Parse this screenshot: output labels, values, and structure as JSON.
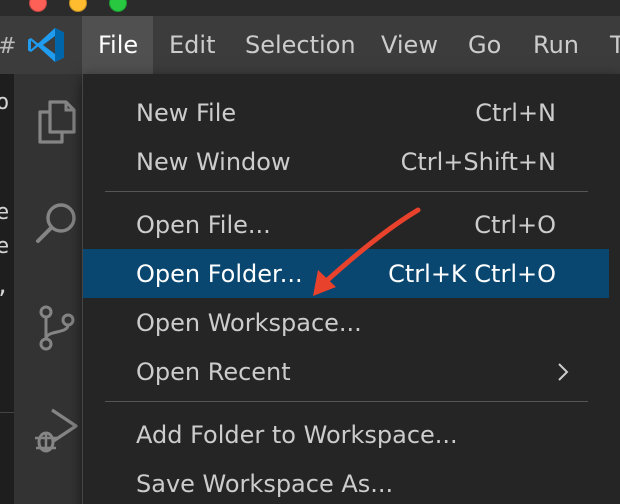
{
  "window": {
    "colors": {
      "close": "#fe5f57",
      "minimize": "#febc2e",
      "maximize": "#28c840"
    }
  },
  "titlebar": {
    "left_fragment": "#",
    "logo_icon": "vscode-logo-icon",
    "menus": [
      {
        "label": "File",
        "active": true
      },
      {
        "label": "Edit"
      },
      {
        "label": "Selection"
      },
      {
        "label": "View"
      },
      {
        "label": "Go"
      },
      {
        "label": "Run"
      },
      {
        "label": "T"
      }
    ]
  },
  "editor_fragments": [
    "o",
    "e",
    "e",
    ","
  ],
  "activity_bar": {
    "icons": [
      "explorer-icon",
      "search-icon",
      "source-control-icon",
      "run-debug-icon"
    ]
  },
  "file_menu": {
    "highlight_color": "#094771",
    "items": [
      {
        "label": "New File",
        "shortcut": "Ctrl+N"
      },
      {
        "label": "New Window",
        "shortcut": "Ctrl+Shift+N"
      },
      {
        "label": "Open File...",
        "shortcut": "Ctrl+O"
      },
      {
        "label": "Open Folder...",
        "shortcut": "Ctrl+K Ctrl+O",
        "highlighted": true
      },
      {
        "label": "Open Workspace...",
        "shortcut": ""
      },
      {
        "label": "Open Recent",
        "submenu": true
      },
      {
        "label": "Add Folder to Workspace...",
        "shortcut": ""
      },
      {
        "label": "Save Workspace As...",
        "shortcut": ""
      }
    ]
  },
  "annotation": {
    "arrow_color": "#e8412c",
    "points_to": "Open Folder..."
  }
}
